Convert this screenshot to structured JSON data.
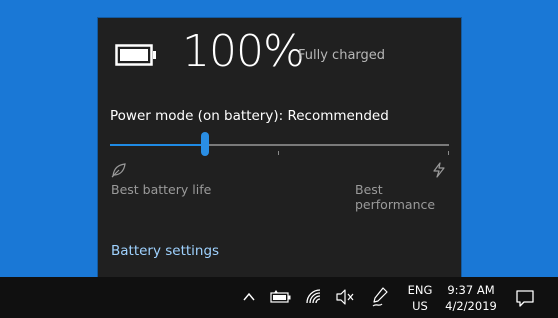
{
  "flyout": {
    "battery_percent": "100%",
    "battery_status": "Fully charged",
    "power_mode_label": "Power mode (on battery): Recommended",
    "slider": {
      "value": 0.28,
      "left_label": "Best battery life",
      "right_label": "Best performance"
    },
    "settings_link": "Battery settings",
    "icons": {
      "battery": "battery-full-icon",
      "leaf": "leaf-icon",
      "bolt": "bolt-icon"
    }
  },
  "taskbar": {
    "icons": [
      "chevron-up-icon",
      "battery-icon",
      "wifi-icon",
      "volume-muted-icon",
      "pen-icon",
      "notifications-icon"
    ],
    "language_line1": "ENG",
    "language_line2": "US",
    "time": "9:37 AM",
    "date": "4/2/2019"
  },
  "colors": {
    "desktop": "#1a78d6",
    "flyout_bg": "#202020",
    "accent": "#1f8ae4",
    "link": "#9fd2ff",
    "taskbar": "#101010"
  }
}
